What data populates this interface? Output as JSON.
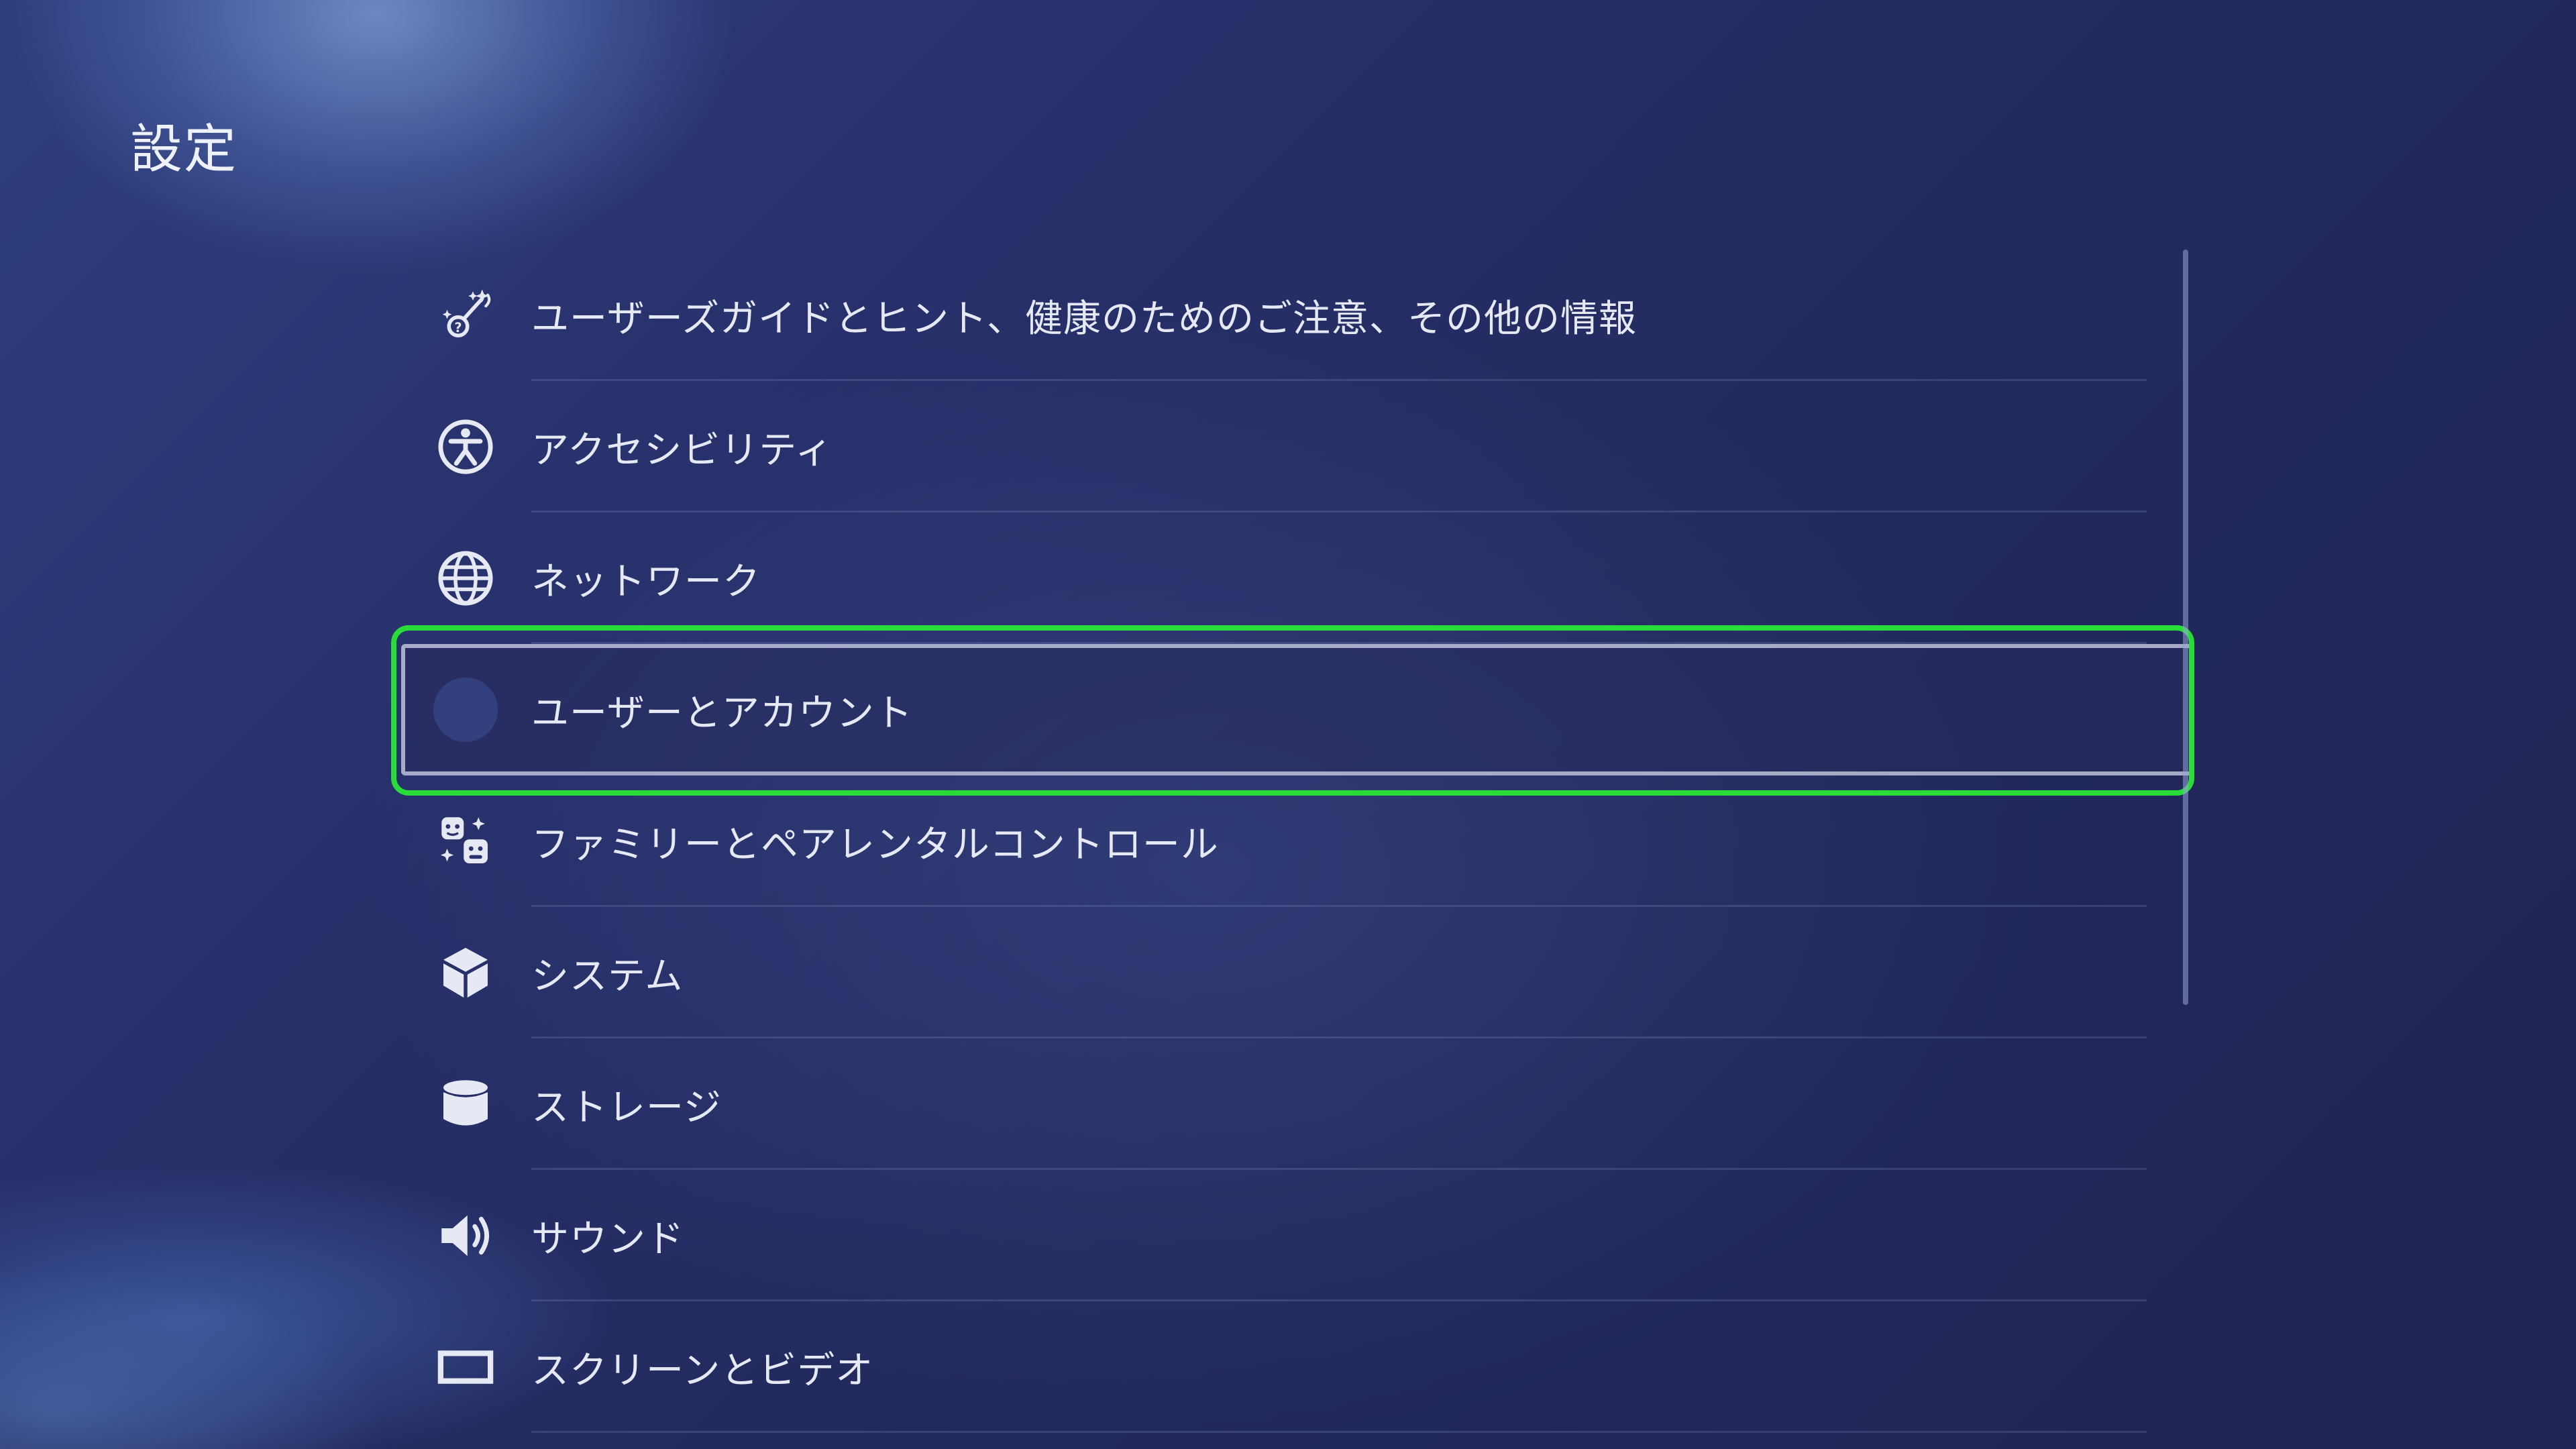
{
  "page": {
    "title": "設定"
  },
  "menu": {
    "items": [
      {
        "label": "ユーザーズガイドとヒント、健康のためのご注意、その他の情報",
        "icon": "guide-sparkle-icon"
      },
      {
        "label": "アクセシビリティ",
        "icon": "accessibility-icon"
      },
      {
        "label": "ネットワーク",
        "icon": "globe-icon"
      },
      {
        "label": "ユーザーとアカウント",
        "icon": "user-avatar-icon",
        "focused": true
      },
      {
        "label": "ファミリーとペアレンタルコントロール",
        "icon": "family-icon"
      },
      {
        "label": "システム",
        "icon": "cube-icon"
      },
      {
        "label": "ストレージ",
        "icon": "storage-cylinder-icon"
      },
      {
        "label": "サウンド",
        "icon": "speaker-icon"
      },
      {
        "label": "スクリーンとビデオ",
        "icon": "screen-icon"
      }
    ]
  },
  "colors": {
    "highlight": "#29dc3a",
    "background": "#232a5e",
    "text": "#e6e9f4"
  }
}
